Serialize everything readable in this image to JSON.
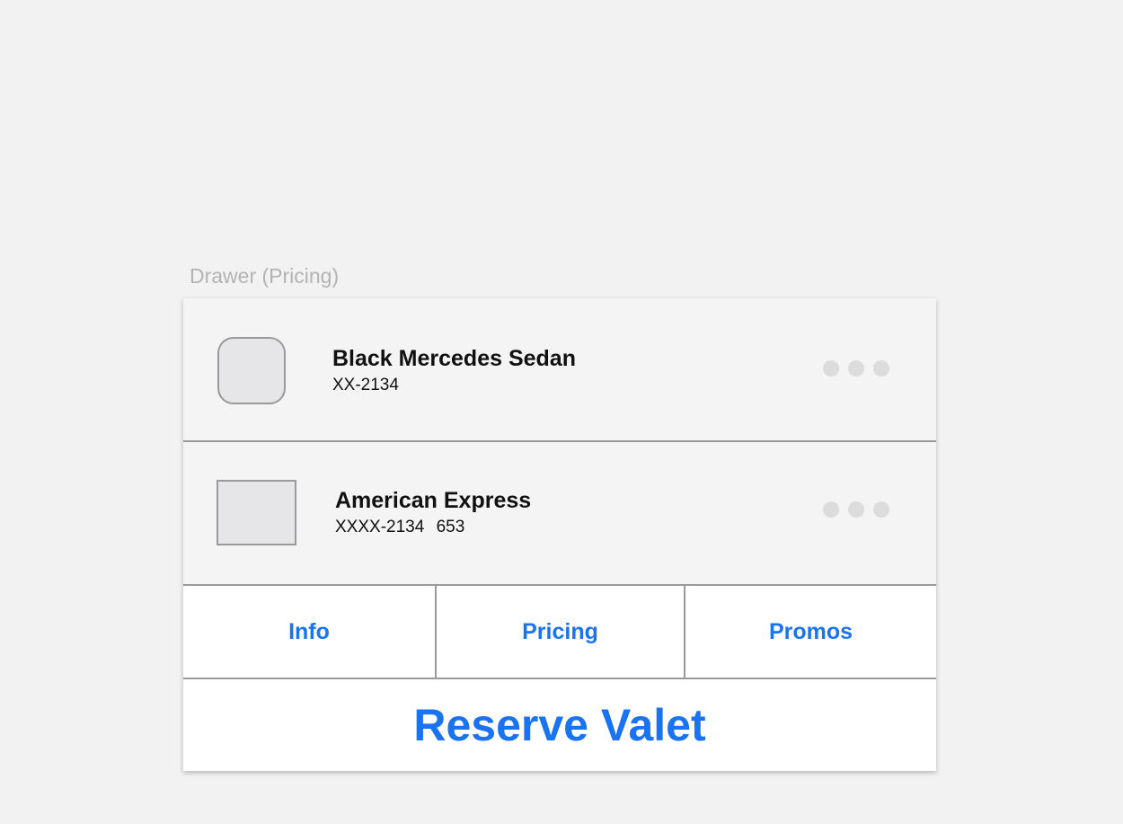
{
  "caption": "Drawer (Pricing)",
  "vehicle": {
    "title": "Black Mercedes Sedan",
    "plate": "XX-2134",
    "thumbnail_icon": "vehicle-thumbnail-icon",
    "more_icon": "more-options-icon"
  },
  "payment": {
    "title": "American Express",
    "card_number": "XXXX-2134 653",
    "thumbnail_icon": "card-thumbnail-icon",
    "more_icon": "more-options-icon"
  },
  "tabs": [
    {
      "label": "Info"
    },
    {
      "label": "Pricing"
    },
    {
      "label": "Promos"
    }
  ],
  "reserve_button": {
    "label": "Reserve Valet"
  },
  "colors": {
    "accent": "#1a73f0",
    "background": "#f2f2f2",
    "divider": "#9a9a9a"
  }
}
